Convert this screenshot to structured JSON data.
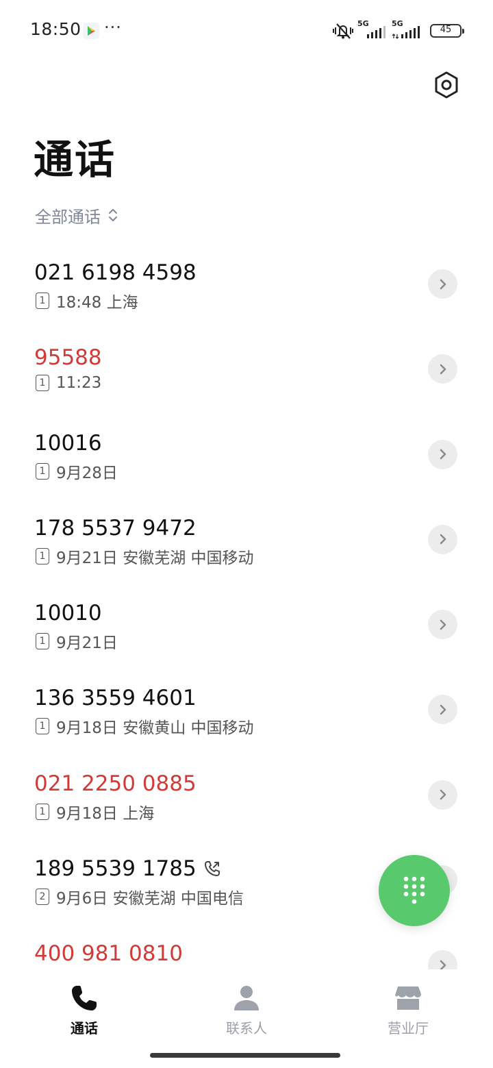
{
  "status_bar": {
    "time": "18:50",
    "more": "···",
    "network1": "5G",
    "network2": "5G",
    "battery": "45",
    "icons": [
      "play-store-icon",
      "mute-vibrate-icon",
      "signal-icon",
      "battery-icon"
    ]
  },
  "header": {
    "title": "通话",
    "filter_label": "全部通话",
    "settings_icon": "gear-icon"
  },
  "calls": [
    {
      "number": "021 6198 4598",
      "missed": false,
      "sim": "1",
      "meta": "18:48 上海"
    },
    {
      "number": "95588",
      "missed": true,
      "sim": "1",
      "meta": "11:23"
    },
    {
      "number": "10016",
      "missed": false,
      "sim": "1",
      "meta": "9月28日"
    },
    {
      "number": "178 5537 9472",
      "missed": false,
      "sim": "1",
      "meta": "9月21日 安徽芜湖 中国移动"
    },
    {
      "number": "10010",
      "missed": false,
      "sim": "1",
      "meta": "9月21日"
    },
    {
      "number": "136 3559 4601",
      "missed": false,
      "sim": "1",
      "meta": "9月18日 安徽黄山 中国移动"
    },
    {
      "number": "021 2250 0885",
      "missed": true,
      "sim": "1",
      "meta": "9月18日 上海"
    },
    {
      "number": "189 5539 1785",
      "missed": false,
      "sim": "2",
      "meta": "9月6日 安徽芜湖 中国电信",
      "outgoing_icon": true
    },
    {
      "number": "400 981 0810",
      "missed": true,
      "sim": "",
      "meta": ""
    }
  ],
  "nav": {
    "calls": "通话",
    "contacts": "联系人",
    "store": "营业厅"
  },
  "colors": {
    "missed": "#d13a36",
    "fab": "#58c96c",
    "filter": "#7f8799"
  }
}
